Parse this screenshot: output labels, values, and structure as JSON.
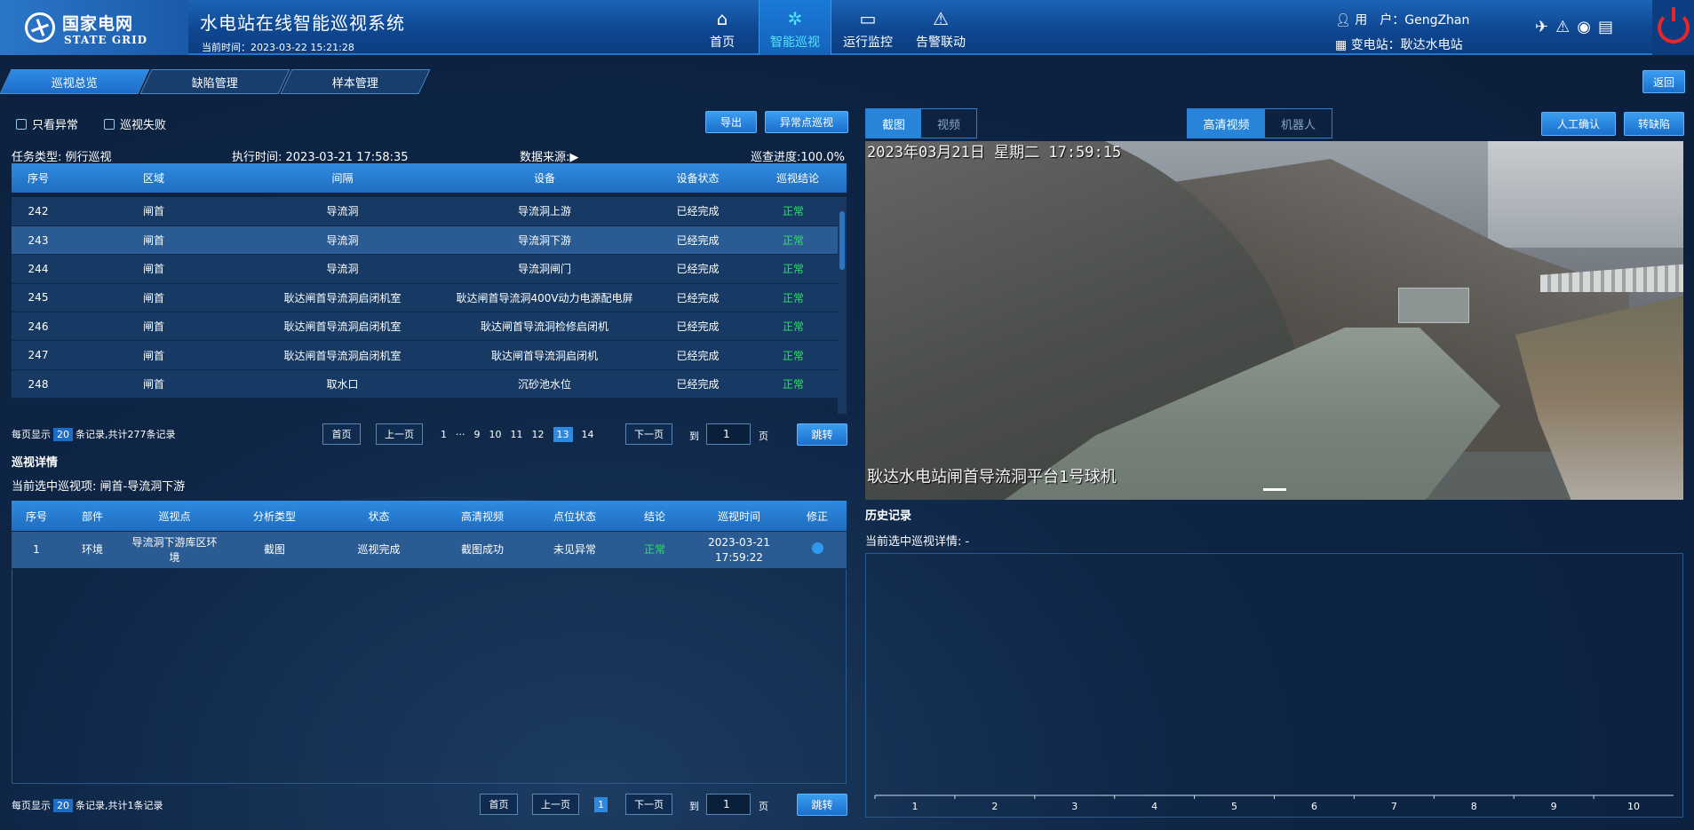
{
  "header": {
    "logo_cn": "国家电网",
    "logo_en": "STATE GRID",
    "system_title": "水电站在线智能巡视系统",
    "current_time": "当前时间：2023-03-22 15:21:28",
    "nav": [
      {
        "label": "首页",
        "icon": "home-icon",
        "active": false
      },
      {
        "label": "智能巡视",
        "icon": "gear-icon",
        "active": true
      },
      {
        "label": "运行监控",
        "icon": "monitor-icon",
        "active": false
      },
      {
        "label": "告警联动",
        "icon": "warning-icon",
        "active": false
      }
    ],
    "user_label": "用　户：GengZhan",
    "station_label": "变电站：耿达水电站"
  },
  "tabs": [
    "巡视总览",
    "缺陷管理",
    "样本管理"
  ],
  "back_label": "返回",
  "filters": {
    "only_abnormal": "只看异常",
    "patrol_failed": "巡视失败"
  },
  "buttons": {
    "export": "导出",
    "abnormal_patrol": "异常点巡视",
    "manual_confirm": "人工确认",
    "to_defect": "转缺陷",
    "jump": "跳转"
  },
  "task_info": {
    "type": "任务类型: 例行巡视",
    "exec_time": "执行时间: 2023-03-21 17:58:35",
    "data_source": "数据来源:",
    "progress": "巡查进度:100.0%"
  },
  "main_table": {
    "columns": [
      "序号",
      "区域",
      "间隔",
      "设备",
      "设备状态",
      "巡视结论"
    ],
    "rows": [
      [
        "242",
        "闸首",
        "导流洞",
        "导流洞上游",
        "已经完成",
        "正常"
      ],
      [
        "243",
        "闸首",
        "导流洞",
        "导流洞下游",
        "已经完成",
        "正常"
      ],
      [
        "244",
        "闸首",
        "导流洞",
        "导流洞闸门",
        "已经完成",
        "正常"
      ],
      [
        "245",
        "闸首",
        "耿达闸首导流洞启闭机室",
        "耿达闸首导流洞400V动力电源配电屏",
        "已经完成",
        "正常"
      ],
      [
        "246",
        "闸首",
        "耿达闸首导流洞启闭机室",
        "耿达闸首导流洞检修启闭机",
        "已经完成",
        "正常"
      ],
      [
        "247",
        "闸首",
        "耿达闸首导流洞启闭机室",
        "耿达闸首导流洞启闭机",
        "已经完成",
        "正常"
      ],
      [
        "248",
        "闸首",
        "取水口",
        "沉砂池水位",
        "已经完成",
        "正常"
      ]
    ],
    "selected_row": 1
  },
  "pager1": {
    "per_page_prefix": "每页显示",
    "per_page": "20",
    "summary": "条记录,共计277条记录",
    "first": "首页",
    "prev": "上一页",
    "pages": [
      "1",
      "···",
      "9",
      "10",
      "11",
      "12",
      "13",
      "14"
    ],
    "current": "13",
    "next": "下一页",
    "goto": "到",
    "input": "1",
    "page_unit": "页"
  },
  "detail": {
    "title": "巡视详情",
    "current": "当前选中巡视项: 闸首-导流洞下游",
    "columns": [
      "序号",
      "部件",
      "巡视点",
      "分析类型",
      "状态",
      "高清视频",
      "点位状态",
      "结论",
      "巡视时间",
      "修正"
    ],
    "row": [
      "1",
      "环境",
      "导流洞下游库区环境",
      "截图",
      "巡视完成",
      "截图成功",
      "未见异常",
      "正常",
      "2023-03-21 17:59:22"
    ]
  },
  "pager2": {
    "per_page_prefix": "每页显示",
    "per_page": "20",
    "summary": "条记录,共计1条记录",
    "first": "首页",
    "prev": "上一页",
    "current": "1",
    "next": "下一页",
    "goto": "到",
    "input": "1",
    "page_unit": "页"
  },
  "media_toggle": [
    "截图",
    "视频"
  ],
  "source_toggle": [
    "高清视频",
    "机器人"
  ],
  "video": {
    "timestamp": "2023年03月21日  星期二 17:59:15",
    "caption": "耿达水电站闸首导流洞平台1号球机"
  },
  "history": {
    "title": "历史记录",
    "current": "当前选中巡视详情: -",
    "x_ticks": [
      "1",
      "2",
      "3",
      "4",
      "5",
      "6",
      "7",
      "8",
      "9",
      "10"
    ]
  }
}
